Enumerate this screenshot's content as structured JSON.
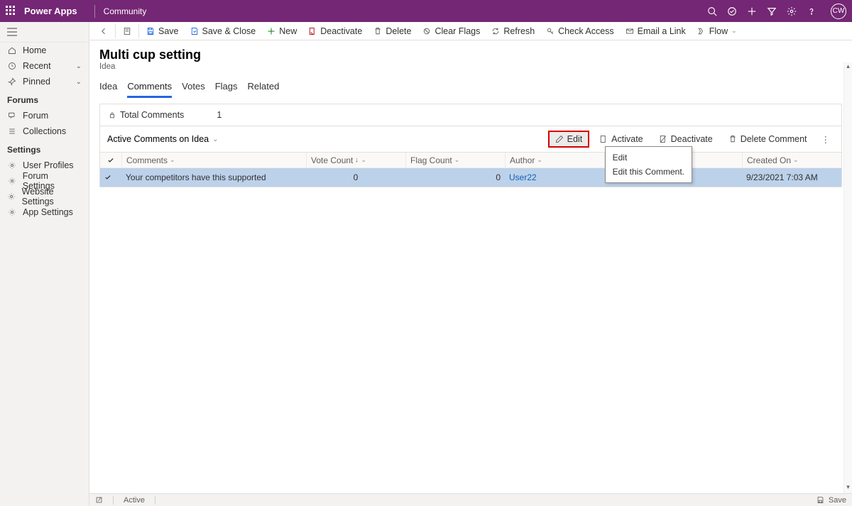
{
  "topbar": {
    "brand": "Power Apps",
    "community": "Community",
    "avatar": "CW"
  },
  "sidebar": {
    "home": "Home",
    "recent": "Recent",
    "pinned": "Pinned",
    "forums_label": "Forums",
    "forum": "Forum",
    "collections": "Collections",
    "settings_label": "Settings",
    "user_profiles": "User Profiles",
    "forum_settings": "Forum Settings",
    "website_settings": "Website Settings",
    "app_settings": "App Settings"
  },
  "cmdbar": {
    "save": "Save",
    "save_close": "Save & Close",
    "new": "New",
    "deactivate": "Deactivate",
    "delete": "Delete",
    "clear_flags": "Clear Flags",
    "refresh": "Refresh",
    "check_access": "Check Access",
    "email_link": "Email a Link",
    "flow": "Flow"
  },
  "header": {
    "title": "Multi cup setting",
    "subtitle": "Idea"
  },
  "tabs": {
    "idea": "Idea",
    "comments": "Comments",
    "votes": "Votes",
    "flags": "Flags",
    "related": "Related"
  },
  "card": {
    "total_label": "Total Comments",
    "total_value": "1",
    "view_title": "Active Comments on Idea",
    "actions": {
      "edit": "Edit",
      "activate": "Activate",
      "deactivate": "Deactivate",
      "delete_comment": "Delete Comment"
    },
    "tooltip": {
      "title": "Edit",
      "body": "Edit this Comment."
    },
    "columns": {
      "comments": "Comments",
      "vote_count": "Vote Count",
      "flag_count": "Flag Count",
      "author": "Author",
      "created_on": "Created On"
    },
    "row": {
      "comment": "Your competitors have this supported",
      "vote": "0",
      "flag": "0",
      "author": "User22",
      "created": "9/23/2021 7:03 AM"
    }
  },
  "statusbar": {
    "status": "Active",
    "save": "Save"
  }
}
